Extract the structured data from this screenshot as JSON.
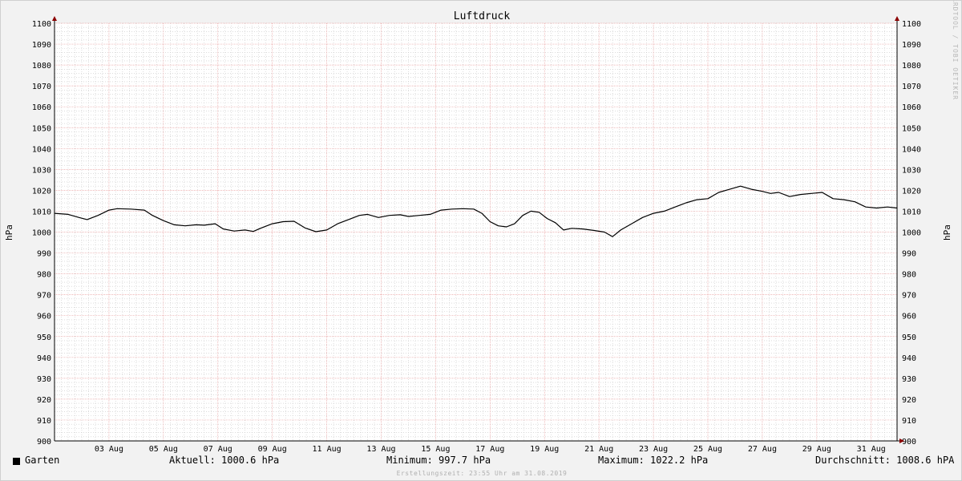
{
  "chart_data": {
    "type": "line",
    "title": "Luftdruck",
    "ylabel": "hPa",
    "watermark": "RRDTOOL / TOBI OETIKER",
    "ylim": [
      900,
      1100
    ],
    "yticks": [
      900,
      910,
      920,
      930,
      940,
      950,
      960,
      970,
      980,
      990,
      1000,
      1010,
      1020,
      1030,
      1040,
      1050,
      1060,
      1070,
      1080,
      1090,
      1100
    ],
    "xlim": [
      1.0,
      31.95
    ],
    "xticks": [
      {
        "day": 3,
        "label": "03 Aug"
      },
      {
        "day": 5,
        "label": "05 Aug"
      },
      {
        "day": 7,
        "label": "07 Aug"
      },
      {
        "day": 9,
        "label": "09 Aug"
      },
      {
        "day": 11,
        "label": "11 Aug"
      },
      {
        "day": 13,
        "label": "13 Aug"
      },
      {
        "day": 15,
        "label": "15 Aug"
      },
      {
        "day": 17,
        "label": "17 Aug"
      },
      {
        "day": 19,
        "label": "19 Aug"
      },
      {
        "day": 21,
        "label": "21 Aug"
      },
      {
        "day": 23,
        "label": "23 Aug"
      },
      {
        "day": 25,
        "label": "25 Aug"
      },
      {
        "day": 27,
        "label": "27 Aug"
      },
      {
        "day": 29,
        "label": "29 Aug"
      },
      {
        "day": 31,
        "label": "31 Aug"
      }
    ],
    "grid": true,
    "colors": {
      "line": "#000000",
      "major_grid": "#e8a0a0",
      "minor_grid": "#c8c8c8",
      "axis": "#8b0000",
      "plot_bg": "#ffffff"
    },
    "series": [
      {
        "name": "Garten",
        "points": [
          [
            1.0,
            1009.0
          ],
          [
            1.5,
            1008.5
          ],
          [
            1.9,
            1007.0
          ],
          [
            2.2,
            1006.0
          ],
          [
            2.6,
            1008.0
          ],
          [
            3.0,
            1010.5
          ],
          [
            3.3,
            1011.2
          ],
          [
            3.8,
            1011.0
          ],
          [
            4.3,
            1010.5
          ],
          [
            4.6,
            1008.0
          ],
          [
            5.0,
            1005.5
          ],
          [
            5.4,
            1003.5
          ],
          [
            5.8,
            1003.0
          ],
          [
            6.2,
            1003.5
          ],
          [
            6.5,
            1003.3
          ],
          [
            6.9,
            1004.0
          ],
          [
            7.2,
            1001.5
          ],
          [
            7.6,
            1000.5
          ],
          [
            8.0,
            1001.0
          ],
          [
            8.3,
            1000.3
          ],
          [
            8.6,
            1002.0
          ],
          [
            9.0,
            1004.0
          ],
          [
            9.4,
            1005.0
          ],
          [
            9.8,
            1005.2
          ],
          [
            10.2,
            1002.0
          ],
          [
            10.6,
            1000.2
          ],
          [
            11.0,
            1001.0
          ],
          [
            11.4,
            1004.0
          ],
          [
            11.8,
            1006.0
          ],
          [
            12.2,
            1008.0
          ],
          [
            12.5,
            1008.5
          ],
          [
            12.9,
            1007.0
          ],
          [
            13.3,
            1008.0
          ],
          [
            13.7,
            1008.3
          ],
          [
            14.0,
            1007.5
          ],
          [
            14.4,
            1008.0
          ],
          [
            14.8,
            1008.5
          ],
          [
            15.2,
            1010.5
          ],
          [
            15.6,
            1011.0
          ],
          [
            16.0,
            1011.2
          ],
          [
            16.4,
            1011.0
          ],
          [
            16.7,
            1009.0
          ],
          [
            17.0,
            1005.0
          ],
          [
            17.3,
            1003.0
          ],
          [
            17.6,
            1002.5
          ],
          [
            17.9,
            1004.0
          ],
          [
            18.2,
            1008.0
          ],
          [
            18.5,
            1010.0
          ],
          [
            18.8,
            1009.5
          ],
          [
            19.1,
            1006.5
          ],
          [
            19.4,
            1004.5
          ],
          [
            19.7,
            1001.0
          ],
          [
            20.0,
            1001.8
          ],
          [
            20.4,
            1001.5
          ],
          [
            20.8,
            1000.8
          ],
          [
            21.2,
            1000.0
          ],
          [
            21.5,
            997.8
          ],
          [
            21.8,
            1001.0
          ],
          [
            22.2,
            1004.0
          ],
          [
            22.6,
            1007.0
          ],
          [
            23.0,
            1009.0
          ],
          [
            23.4,
            1010.0
          ],
          [
            23.8,
            1012.0
          ],
          [
            24.2,
            1014.0
          ],
          [
            24.6,
            1015.5
          ],
          [
            25.0,
            1016.0
          ],
          [
            25.4,
            1019.0
          ],
          [
            25.8,
            1020.5
          ],
          [
            26.2,
            1022.0
          ],
          [
            26.6,
            1020.5
          ],
          [
            27.0,
            1019.5
          ],
          [
            27.3,
            1018.5
          ],
          [
            27.6,
            1019.0
          ],
          [
            28.0,
            1017.0
          ],
          [
            28.4,
            1018.0
          ],
          [
            28.8,
            1018.5
          ],
          [
            29.2,
            1019.0
          ],
          [
            29.6,
            1016.0
          ],
          [
            30.0,
            1015.5
          ],
          [
            30.4,
            1014.5
          ],
          [
            30.8,
            1012.0
          ],
          [
            31.2,
            1011.5
          ],
          [
            31.6,
            1012.0
          ],
          [
            31.95,
            1011.5
          ]
        ]
      }
    ]
  },
  "legend": {
    "series_name": "Garten",
    "current": "Aktuell: 1000.6 hPa",
    "minimum": "Minimum: 997.7 hPa",
    "maximum": "Maximum: 1022.2 hPa",
    "average": "Durchschnitt: 1008.6 hPA"
  },
  "footer": "Erstellungszeit: 23:55 Uhr am 31.08.2019"
}
